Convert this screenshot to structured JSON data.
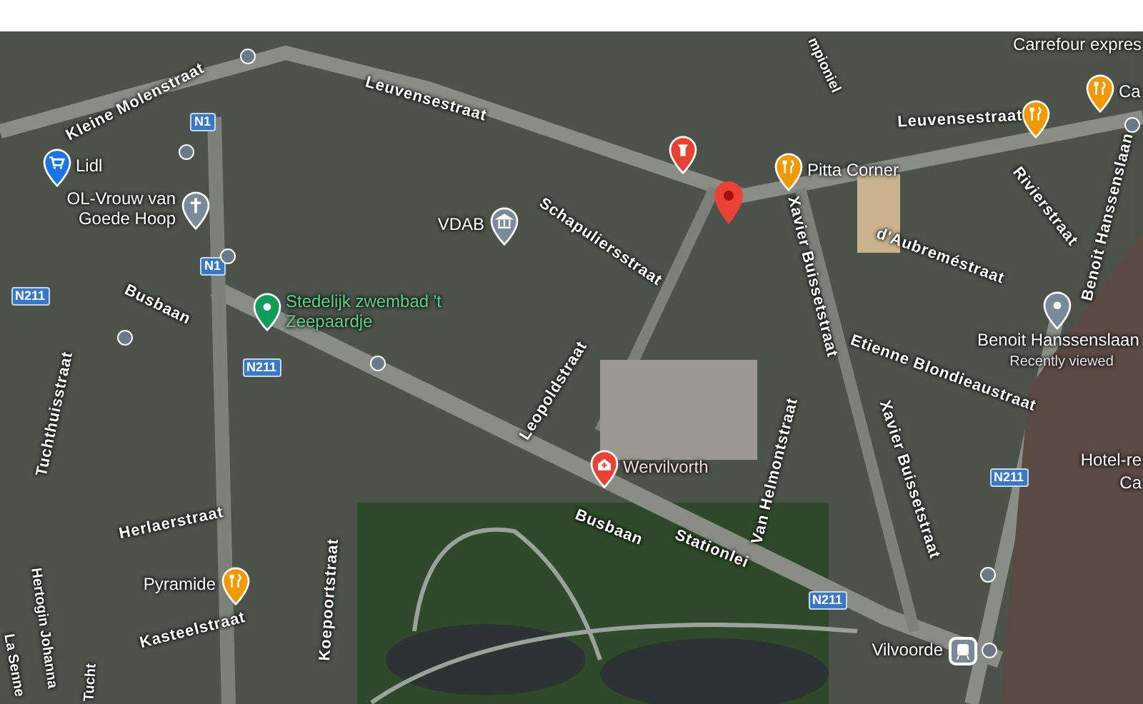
{
  "map": {
    "places": [
      {
        "kind": "shop",
        "label": "Lidl",
        "color": "#1a73e8"
      },
      {
        "kind": "church",
        "label": "OL-Vrouw van Goede Hoop",
        "color": "#7b8a96"
      },
      {
        "kind": "pool",
        "label": "Stedelijk zwembad 't Zeepaardje",
        "color": "#0f9d58"
      },
      {
        "kind": "government",
        "label": "VDAB",
        "color": "#7b8a96"
      },
      {
        "kind": "museum",
        "color": "#e94235"
      },
      {
        "kind": "restaurant",
        "label": "Pitta Corner",
        "color": "#f29900"
      },
      {
        "kind": "restaurant",
        "color": "#f29900"
      },
      {
        "kind": "restaurant",
        "label": "Ca",
        "color": "#f29900"
      },
      {
        "kind": "place",
        "label": "Benoit Hanssenslaan",
        "sublabel": "Recently viewed",
        "color": "#7b8a96"
      },
      {
        "kind": "hospital",
        "label": "Wervilvorth",
        "color": "#e94235"
      },
      {
        "kind": "restaurant",
        "label": "Pyramide",
        "color": "#f29900"
      },
      {
        "kind": "train",
        "label": "Vilvoorde",
        "color": "#7b8a96"
      }
    ],
    "selected_marker": {
      "color": "#ea4335"
    },
    "streets": [
      "Kleine Molenstraat",
      "Leuvensestraat",
      "Leuvensestraat",
      "mpioniel",
      "Schapuliersstraat",
      "Busbaan",
      "Busbaan",
      "Stationlei",
      "Leopoldstraat",
      "Xavier Buissetstraat",
      "Xavier Buissetstraat",
      "d'Aubreméstraat",
      "Rivierstraat",
      "Benoit Hanssenslaan",
      "Etienne Blondieaustraat",
      "Van Helmontstraat",
      "Herlaerstraat",
      "Kasteelstraat",
      "Koepoortstraat",
      "Tuchthuisstraat",
      "Hertogin Johanna",
      "La Senne",
      "Tucht"
    ],
    "road_shields": [
      "N1",
      "N1",
      "N211",
      "N211",
      "N211",
      "N211"
    ],
    "other_labels": [
      "Carrefour expres",
      "Hotel-re",
      "Ca"
    ]
  }
}
